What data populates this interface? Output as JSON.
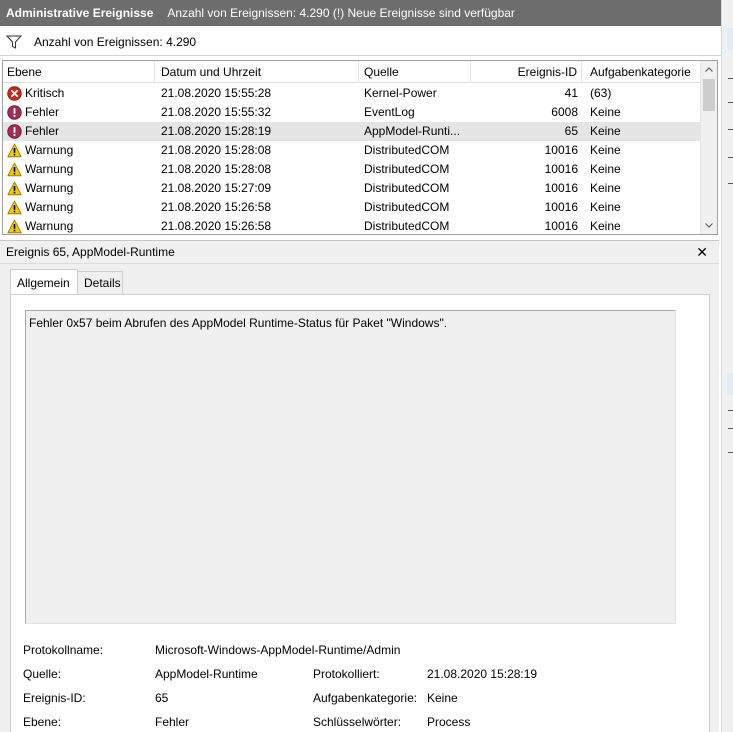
{
  "titlebar": {
    "title": "Administrative Ereignisse",
    "subtitle": "Anzahl von Ereignissen: 4.290 (!) Neue Ereignisse sind verfügbar"
  },
  "filter": {
    "icon": "funnel-icon",
    "text": "Anzahl von Ereignissen: 4.290"
  },
  "columns": {
    "level": "Ebene",
    "date": "Datum und Uhrzeit",
    "source": "Quelle",
    "id": "Ereignis-ID",
    "category": "Aufgabenkategorie"
  },
  "events": [
    {
      "level": "Kritisch",
      "icon": "critical-icon",
      "date": "21.08.2020 15:55:28",
      "source": "Kernel-Power",
      "id": "41",
      "category": "(63)"
    },
    {
      "level": "Fehler",
      "icon": "error-icon",
      "date": "21.08.2020 15:55:32",
      "source": "EventLog",
      "id": "6008",
      "category": "Keine"
    },
    {
      "level": "Fehler",
      "icon": "error-icon",
      "date": "21.08.2020 15:28:19",
      "source": "AppModel-Runti...",
      "id": "65",
      "category": "Keine"
    },
    {
      "level": "Warnung",
      "icon": "warning-icon",
      "date": "21.08.2020 15:28:08",
      "source": "DistributedCOM",
      "id": "10016",
      "category": "Keine"
    },
    {
      "level": "Warnung",
      "icon": "warning-icon",
      "date": "21.08.2020 15:28:08",
      "source": "DistributedCOM",
      "id": "10016",
      "category": "Keine"
    },
    {
      "level": "Warnung",
      "icon": "warning-icon",
      "date": "21.08.2020 15:27:09",
      "source": "DistributedCOM",
      "id": "10016",
      "category": "Keine"
    },
    {
      "level": "Warnung",
      "icon": "warning-icon",
      "date": "21.08.2020 15:26:58",
      "source": "DistributedCOM",
      "id": "10016",
      "category": "Keine"
    },
    {
      "level": "Warnung",
      "icon": "warning-icon",
      "date": "21.08.2020 15:26:58",
      "source": "DistributedCOM",
      "id": "10016",
      "category": "Keine"
    }
  ],
  "selected_index": 2,
  "detail": {
    "header": "Ereignis 65, AppModel-Runtime",
    "tabs": [
      "Allgemein",
      "Details"
    ],
    "active_tab": "Allgemein",
    "message": "Fehler 0x57 beim Abrufen des AppModel Runtime-Status für Paket \"Windows\".",
    "props": {
      "logname_label": "Protokollname:",
      "logname_value": "Microsoft-Windows-AppModel-Runtime/Admin",
      "source_label": "Quelle:",
      "source_value": "AppModel-Runtime",
      "logged_label": "Protokolliert:",
      "logged_value": "21.08.2020 15:28:19",
      "eventid_label": "Ereignis-ID:",
      "eventid_value": "65",
      "category_label": "Aufgabenkategorie:",
      "category_value": "Keine",
      "level_label": "Ebene:",
      "level_value": "Fehler",
      "keywords_label": "Schlüsselwörter:",
      "keywords_value": "Process"
    }
  },
  "colors": {
    "titlebar": "#6d6d6d",
    "selected_row": "#e5e5e5",
    "critical": "#c42b1c",
    "error": "#9b2f56",
    "warning": "#f2c811"
  }
}
